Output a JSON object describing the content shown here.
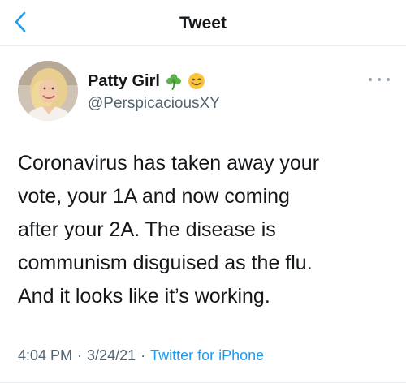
{
  "header": {
    "title": "Tweet",
    "back_icon": "chevron-left-icon"
  },
  "tweet": {
    "author": {
      "display_name": "Patty Girl",
      "emojis": [
        "shamrock-icon",
        "winking-face-icon"
      ],
      "handle": "@PerspicaciousXY"
    },
    "text": "Coronavirus has taken away your\nvote, your 1A and now coming\nafter your 2A. The disease is\ncommunism disguised as the flu.\nAnd it looks like it’s working.",
    "time": "4:04 PM",
    "date": "3/24/21",
    "separator": "·",
    "source": "Twitter for iPhone"
  },
  "colors": {
    "accent": "#1d9bf0",
    "text": "#14171a",
    "secondary": "#536471",
    "divider": "#e6ecf0"
  }
}
